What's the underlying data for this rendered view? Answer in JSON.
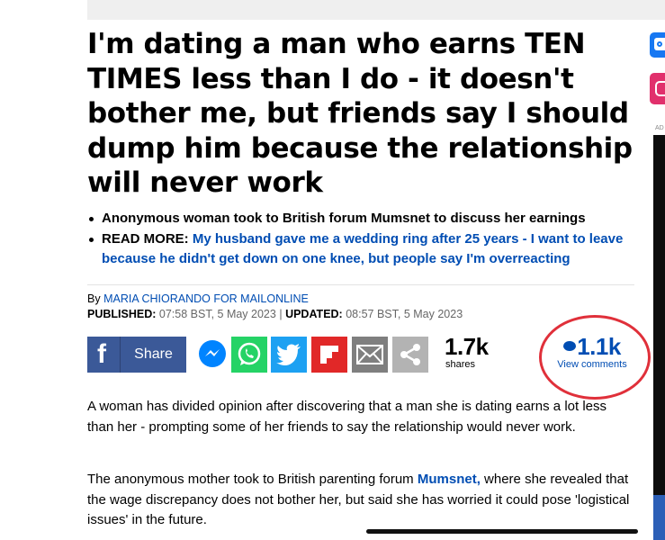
{
  "article": {
    "headline": "I'm dating a man who earns TEN TIMES less than I do - it doesn't bother me, but friends say I should dump him because the relationship will never work",
    "bullets": [
      {
        "text": "Anonymous woman took to British forum Mumsnet to discuss her earnings"
      },
      {
        "label": "READ MORE:",
        "link": "My husband gave me a wedding ring after 25 years - I want to leave because he didn't get down on one knee, but people say I'm overreacting"
      }
    ],
    "byline": {
      "prefix": "By",
      "author": "MARIA CHIORANDO FOR MAILONLINE"
    },
    "published_label": "PUBLISHED:",
    "published_value": "07:58 BST, 5 May 2023",
    "separator": "|",
    "updated_label": "UPDATED:",
    "updated_value": "08:57 BST, 5 May 2023",
    "paragraph1": "A woman has divided opinion after discovering that a man she is dating earns a lot less than her - prompting some of her friends to say the relationship would never work.",
    "paragraph2_before": "The anonymous mother took to British parenting forum ",
    "paragraph2_link": "Mumsnet,",
    "paragraph2_after": " where she revealed that the wage discrepancy does not bother her, but said she has worried it could pose 'logistical issues' in the future."
  },
  "share": {
    "facebook_glyph": "f",
    "facebook_label": "Share",
    "icons": [
      "messenger-icon",
      "whatsapp-icon",
      "twitter-icon",
      "flipboard-icon",
      "email-icon",
      "share-icon"
    ],
    "count": "1.7k",
    "count_label": "shares"
  },
  "comments": {
    "count": "1.1k",
    "label": "View comments"
  },
  "sidebar": {
    "ad_label": "AD"
  },
  "colors": {
    "link": "#004db3",
    "facebook": "#3b5998",
    "messenger": "#0084ff",
    "whatsapp": "#25d366",
    "twitter": "#1da1f2",
    "flipboard": "#e12828",
    "email": "#7f7f7f",
    "share": "#b3b3b3",
    "highlight_circle": "#e0303a"
  }
}
